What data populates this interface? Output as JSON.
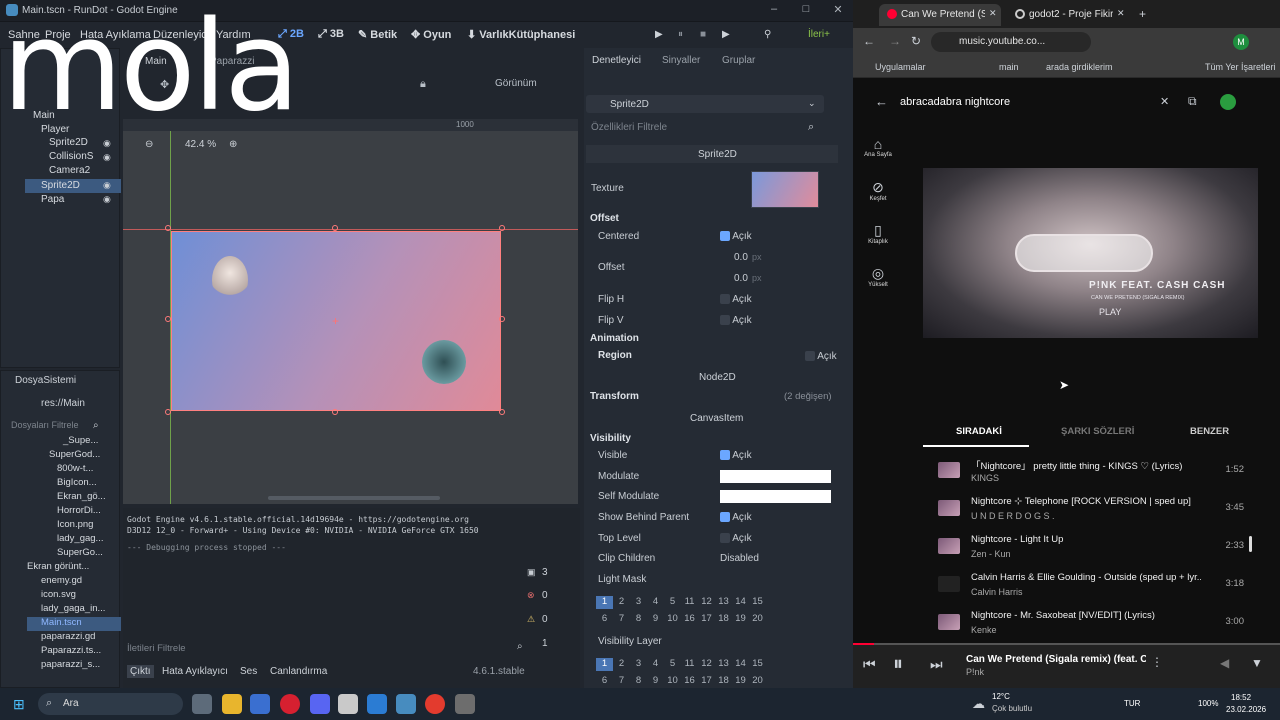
{
  "godot": {
    "window_title": "Main.tscn - RunDot - Godot Engine",
    "menus": [
      "Sahne",
      "Proje",
      "Hata Ayıklama",
      "Düzenleyici",
      "Yardım"
    ],
    "workspaces": [
      "2B",
      "3B",
      "Betik",
      "Oyun",
      "VarlıkKütüphanesi"
    ],
    "renderer": "İleri+",
    "scene_tab": "Main",
    "scene_tab2": "Paparazzi",
    "view_label": "Görünüm",
    "zoom": "42.4 %",
    "ruler_mark": "1000",
    "scene_tree": [
      "Main",
      "Player",
      "Sprite2D",
      "CollisionS",
      "Camera2",
      "Sprite2D",
      "Papa"
    ],
    "filesystem": {
      "header": "DosyaSistemi",
      "path": "res://Main",
      "filter_placeholder": "Dosyaları Filtrele",
      "items": [
        "_Supe...",
        "SuperGod...",
        "800w-t...",
        "BigIcon...",
        "Ekran_gö...",
        "HorrorDi...",
        "Icon.png",
        "lady_gag...",
        "SuperGo...",
        "Ekran görünt...",
        "enemy.gd",
        "icon.svg",
        "lady_gaga_in...",
        "Main.tscn",
        "paparazzi.gd",
        "Paparazzi.ts...",
        "paparazzi_s..."
      ]
    },
    "inspector": {
      "tabs": [
        "Denetleyici",
        "Sinyaller",
        "Gruplar"
      ],
      "node": "Sprite2D",
      "filter_placeholder": "Özellikleri Filtrele",
      "class_header": "Sprite2D",
      "texture_label": "Texture",
      "offset_section": "Offset",
      "centered": "Centered",
      "on_label": "Açık",
      "offset_label": "Offset",
      "offset_x": "0.0",
      "offset_y": "0.0",
      "unit": "px",
      "flip_h": "Flip H",
      "flip_v": "Flip V",
      "animation": "Animation",
      "region": "Region",
      "node2d": "Node2D",
      "transform": "Transform",
      "transform_note": "(2 değişen)",
      "canvasitem": "CanvasItem",
      "visibility": "Visibility",
      "visible": "Visible",
      "modulate": "Modulate",
      "self_modulate": "Self Modulate",
      "show_behind": "Show Behind Parent",
      "top_level": "Top Level",
      "clip_children": "Clip Children",
      "clip_value": "Disabled",
      "light_mask": "Light Mask",
      "visibility_layer": "Visibility Layer",
      "layers_row1": [
        "1",
        "2",
        "3",
        "4",
        "5",
        "11",
        "12",
        "13",
        "14",
        "15"
      ],
      "layers_row2": [
        "6",
        "7",
        "8",
        "9",
        "10",
        "16",
        "17",
        "18",
        "19",
        "20"
      ]
    },
    "output": {
      "line1": "Godot Engine v4.6.1.stable.official.14d19694e - https://godotengine.org",
      "line2": "D3D12 12_0 - Forward+ - Using Device #0: NVIDIA - NVIDIA GeForce GTX 1650",
      "line3": "--- Debugging process stopped ---",
      "filter_placeholder": "İletileri Filtrele",
      "counts": [
        "3",
        "0",
        "0",
        "1"
      ],
      "bottom_tabs": [
        "Çıktı",
        "Hata Ayıklayıcı",
        "Ses",
        "Canlandırma"
      ],
      "version": "4.6.1.stable"
    }
  },
  "overlay_text": "mola",
  "chrome": {
    "tab1": "Can We Pretend (S...",
    "tab2": "godot2 - Proje Fikirler...",
    "url": "music.youtube.co...",
    "bookmarks": [
      "Uygulamalar",
      "main",
      "arada girdiklerim",
      "Tüm Yer İşaretleri"
    ],
    "profile": "M"
  },
  "youtube": {
    "search": "abracadabra nightcore",
    "nav": [
      "Ana Sayfa",
      "Keşfet",
      "Kitaplık",
      "Yükselt"
    ],
    "art_text1": "P!NK FEAT. CASH CASH",
    "art_text2": "CAN WE PRETEND (SIGALA REMIX)",
    "art_text3": "PLAY",
    "tabs": [
      "SIRADAKİ",
      "ŞARKI SÖZLERİ",
      "BENZER"
    ],
    "queue": [
      {
        "title": "「Nightcore」 pretty little thing - KINGS ♡ (Lyrics)",
        "artist": "KINGS",
        "duration": "1:52"
      },
      {
        "title": "Nightcore ⊹ Telephone [ROCK VERSION | sped up]",
        "artist": "U N D E R D O G S .",
        "duration": "3:45"
      },
      {
        "title": "Nightcore - Light It Up",
        "artist": "Zen - Kun",
        "duration": "2:33"
      },
      {
        "title": "Calvin Harris & Ellie Goulding - Outside (sped up + lyr...",
        "artist": "Calvin Harris",
        "duration": "3:18"
      },
      {
        "title": "Nightcore - Mr. Saxobeat [NV/EDIT] (Lyrics)",
        "artist": "Kenke",
        "duration": "3:00"
      }
    ],
    "now_playing": "Can We Pretend (Sigala remix) (feat. Ca...",
    "now_artist": "P!nk",
    "progress": 0.05
  },
  "taskbar": {
    "search": "Ara",
    "weather_temp": "12°C",
    "weather_desc": "Çok bulutlu",
    "lang": "TUR",
    "battery": "100%",
    "time": "18:52",
    "date": "23.02.2026"
  }
}
